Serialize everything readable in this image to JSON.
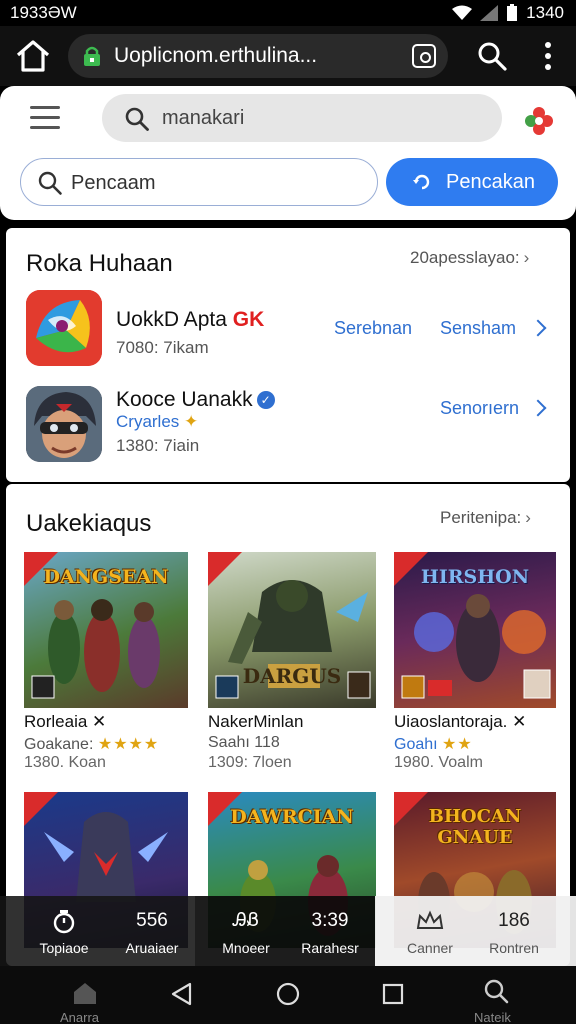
{
  "status_bar": {
    "time": "1933ƏW",
    "clock": "1340"
  },
  "browser": {
    "url": "Uoplicnom.erthulina..."
  },
  "search": {
    "placeholder_top": "manakari",
    "query": "Pencaam",
    "button_label": "Pencakan"
  },
  "section1": {
    "title": "Roka Huhaan",
    "more": "20apesslayao:",
    "apps": [
      {
        "name": "UokkD Apta",
        "badge": "GK",
        "sub": "7080: 7ikam",
        "actions": [
          "Serebnan",
          "Sensham"
        ]
      },
      {
        "name": "Kooce Uanakk",
        "category": "Cryarles",
        "sub": "1380: 7iain",
        "actions": [
          "Senorıern"
        ]
      }
    ]
  },
  "section2": {
    "title": "Uakekiaqus",
    "more": "Peritenipa:",
    "games": [
      {
        "banner": "DANGSEAN",
        "name": "Rorleaia ✕",
        "sub_label": "Goakane:",
        "stars": "★★★★",
        "meta": "1380. Koan"
      },
      {
        "banner": "DARGUS",
        "name": "NakerMinlan",
        "sub_label": "Saahı 118",
        "meta": "1309: 7loen"
      },
      {
        "banner": "HIRSHON",
        "name": "Uiaoslantoraja. ✕",
        "sub_label": "Goahı",
        "stars": "★★",
        "meta": "1980. Voalm"
      },
      {
        "banner": ""
      },
      {
        "banner": "DAWRCIAN"
      },
      {
        "banner": "BHOCAN GNAUE"
      }
    ]
  },
  "bottom_bar": {
    "items": [
      {
        "top": "",
        "label": "Topiaoe"
      },
      {
        "top": "556",
        "label": "Aruaiaer"
      },
      {
        "top": "ᎯᏰ",
        "label": "Mnoeer"
      },
      {
        "top": "3:39",
        "label": "Rarahesr"
      },
      {
        "top": "",
        "label": "Canner"
      },
      {
        "top": "186",
        "label": "Rontren"
      }
    ]
  },
  "nav": {
    "home_label": "Anarra",
    "search_label": "Nateik"
  },
  "colors": {
    "accent": "#2f7cf0",
    "link": "#2f6fd0",
    "badge_red": "#e02020"
  }
}
